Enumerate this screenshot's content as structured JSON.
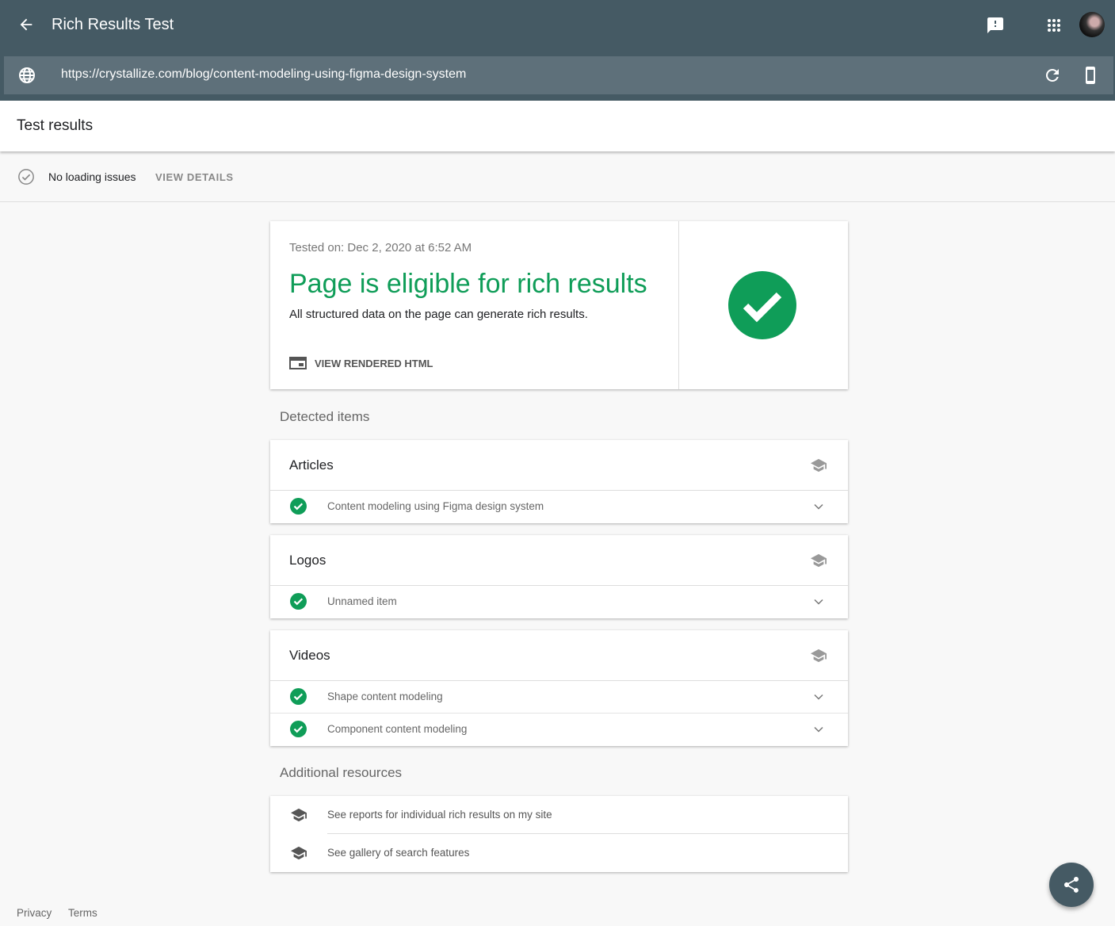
{
  "header": {
    "title": "Rich Results Test",
    "url": "https://crystallize.com/blog/content-modeling-using-figma-design-system"
  },
  "subheader": {
    "title": "Test results"
  },
  "status": {
    "label": "No loading issues",
    "details": "VIEW DETAILS"
  },
  "summary": {
    "tested_on": "Tested on: Dec 2, 2020 at 6:52 AM",
    "headline": "Page is eligible for rich results",
    "description": "All structured data on the page can generate rich results.",
    "view_html": "VIEW RENDERED HTML",
    "accent": "#0f9d58"
  },
  "detected": {
    "title": "Detected items",
    "groups": [
      {
        "title": "Articles",
        "items": [
          "Content modeling using Figma design system"
        ]
      },
      {
        "title": "Logos",
        "items": [
          "Unnamed item"
        ]
      },
      {
        "title": "Videos",
        "items": [
          "Shape content modeling",
          "Component content modeling"
        ]
      }
    ]
  },
  "resources": {
    "title": "Additional resources",
    "items": [
      "See reports for individual rich results on my site",
      "See gallery of search features"
    ]
  },
  "footer": {
    "privacy": "Privacy",
    "terms": "Terms"
  }
}
